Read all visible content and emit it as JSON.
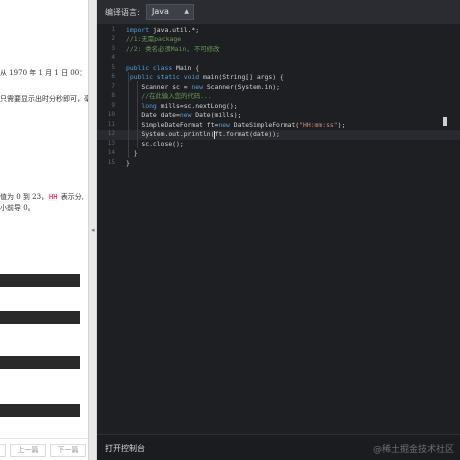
{
  "problem": {
    "line1": "从 1970 年 1 月 1 日 00：",
    "line2": "只需要显示出时分秒即可，毫",
    "line3_pre": "值为 0 到 23，",
    "line3_code": "HH",
    "line3_post": " 表示分,",
    "line4": "小前导 0。"
  },
  "pager": {
    "prev": "上一篇",
    "next": "下一篇"
  },
  "toolbar": {
    "lang_label": "编译语言:",
    "lang_value": "Java"
  },
  "code": {
    "line_numbers": [
      "1",
      "2",
      "3",
      "4",
      "5",
      "6",
      "7",
      "8",
      "9",
      "10",
      "11",
      "12",
      "13",
      "14",
      "15"
    ],
    "lines": [
      [
        [
          "kw",
          "import"
        ],
        [
          "plain",
          " java.util.*;"
        ]
      ],
      [
        [
          "cm",
          "//1:无需package"
        ]
      ],
      [
        [
          "cm",
          "//2: 类名必须Main, 不可修改"
        ]
      ],
      [],
      [
        [
          "kw",
          "public class"
        ],
        [
          "plain",
          " Main {"
        ]
      ],
      [
        [
          "plain",
          " "
        ],
        [
          "kw",
          "public static void"
        ],
        [
          "plain",
          " main(String[] args) {"
        ]
      ],
      [
        [
          "plain",
          "    Scanner sc = "
        ],
        [
          "kw",
          "new"
        ],
        [
          "plain",
          " Scanner(System.in);"
        ]
      ],
      [
        [
          "cm",
          "    //在此输入您的代码..."
        ]
      ],
      [
        [
          "plain",
          "    "
        ],
        [
          "kw",
          "long"
        ],
        [
          "plain",
          " mills=sc.nextLong();"
        ]
      ],
      [
        [
          "plain",
          "    Date date="
        ],
        [
          "kw",
          "new"
        ],
        [
          "plain",
          " Date(mills);"
        ]
      ],
      [
        [
          "plain",
          "    SimpleDateFormat ft="
        ],
        [
          "kw",
          "new"
        ],
        [
          "plain",
          " DateSimpleFormat("
        ],
        [
          "str",
          "\"HH:mm:ss\""
        ],
        [
          "plain",
          ");"
        ]
      ],
      [
        [
          "plain",
          "    System.out.println(ft.format(date));"
        ]
      ],
      [
        [
          "plain",
          "    sc.close();"
        ]
      ],
      [
        [
          "plain",
          "  }"
        ]
      ],
      [
        [
          "plain",
          "}"
        ]
      ]
    ]
  },
  "footer": {
    "console": "打开控制台",
    "watermark": "@稀土掘金技术社区"
  }
}
